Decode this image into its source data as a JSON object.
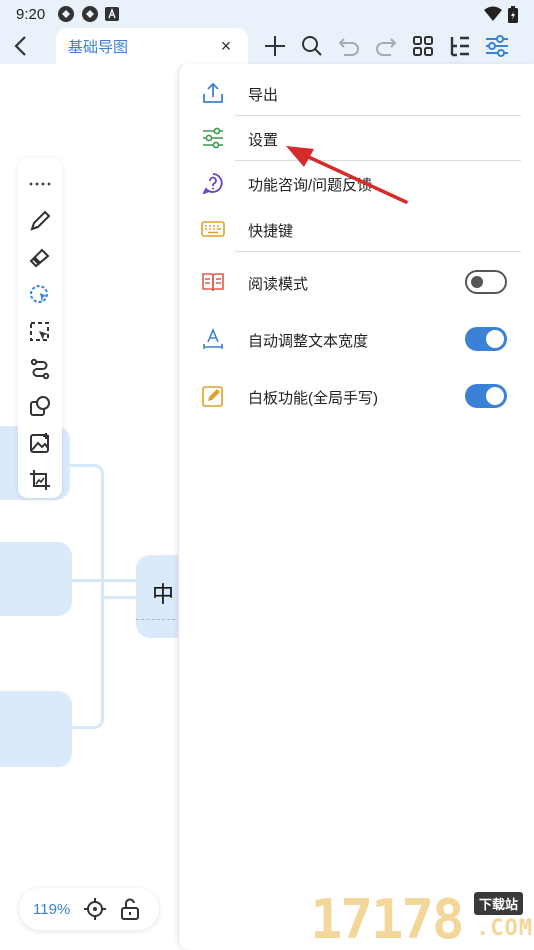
{
  "status_bar": {
    "time": "9:20"
  },
  "toolbar": {
    "tab_title": "基础导图",
    "tab_close": "×"
  },
  "canvas": {
    "central_node_text": "中",
    "zoom_level": "119%"
  },
  "menu": {
    "items": [
      {
        "label": "导出",
        "icon": "export-icon"
      },
      {
        "label": "设置",
        "icon": "settings-sliders-icon"
      },
      {
        "label": "功能咨询/问题反馈",
        "icon": "question-icon"
      },
      {
        "label": "快捷键",
        "icon": "keyboard-icon"
      },
      {
        "label": "阅读模式",
        "icon": "book-icon",
        "toggle": false
      },
      {
        "label": "自动调整文本宽度",
        "icon": "text-width-icon",
        "toggle": true
      },
      {
        "label": "白板功能(全局手写)",
        "icon": "whiteboard-pen-icon",
        "toggle": true
      }
    ]
  },
  "watermark": {
    "digits": "17178",
    "badge": "下载站",
    "domain": ".COM"
  },
  "colors": {
    "accent": "#3b82d6",
    "node_fill": "#dbeafb",
    "annotation_arrow": "#d62b2b"
  }
}
